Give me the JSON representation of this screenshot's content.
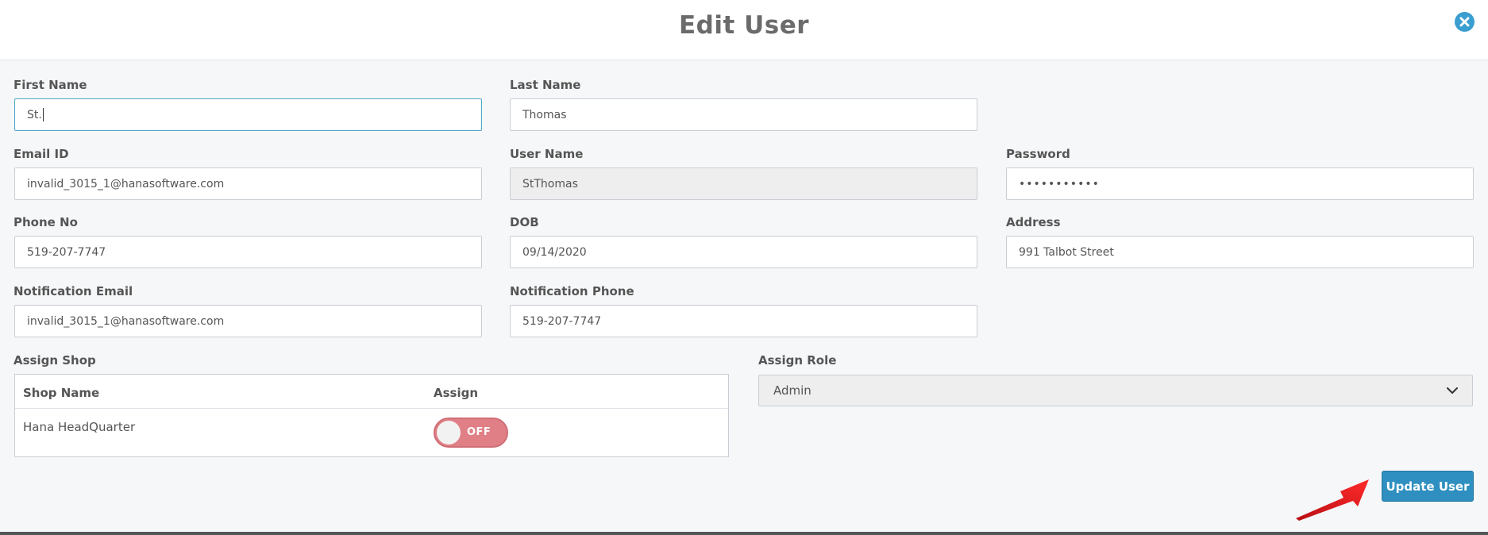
{
  "dialog": {
    "title": "Edit User"
  },
  "form": {
    "first_name": {
      "label": "First Name",
      "value": "St."
    },
    "last_name": {
      "label": "Last Name",
      "value": "Thomas"
    },
    "email": {
      "label": "Email ID",
      "value": "invalid_3015_1@hanasoftware.com"
    },
    "user_name": {
      "label": "User Name",
      "value": "StThomas"
    },
    "password": {
      "label": "Password",
      "value": "•••••••••••"
    },
    "phone": {
      "label": "Phone No",
      "value": "519-207-7747"
    },
    "dob": {
      "label": "DOB",
      "value": "09/14/2020"
    },
    "address": {
      "label": "Address",
      "value": "991 Talbot Street"
    },
    "notification_email": {
      "label": "Notification Email",
      "value": "invalid_3015_1@hanasoftware.com"
    },
    "notification_phone": {
      "label": "Notification Phone",
      "value": "519-207-7747"
    }
  },
  "assign_shop": {
    "label": "Assign Shop",
    "columns": [
      "Shop Name",
      "Assign"
    ],
    "rows": [
      {
        "shop_name": "Hana HeadQuarter",
        "assign_state": "OFF"
      }
    ]
  },
  "assign_role": {
    "label": "Assign Role",
    "selected": "Admin"
  },
  "actions": {
    "update_label": "Update User"
  },
  "colors": {
    "accent": "#2f8fc0",
    "close_icon": "#3a9ed0",
    "toggle_off": "#e07f86",
    "annotation_arrow": "#e8141b"
  },
  "icons": {
    "close": "close-icon",
    "dropdown": "chevron-down-icon",
    "annotation": "red-arrow-annotation"
  }
}
